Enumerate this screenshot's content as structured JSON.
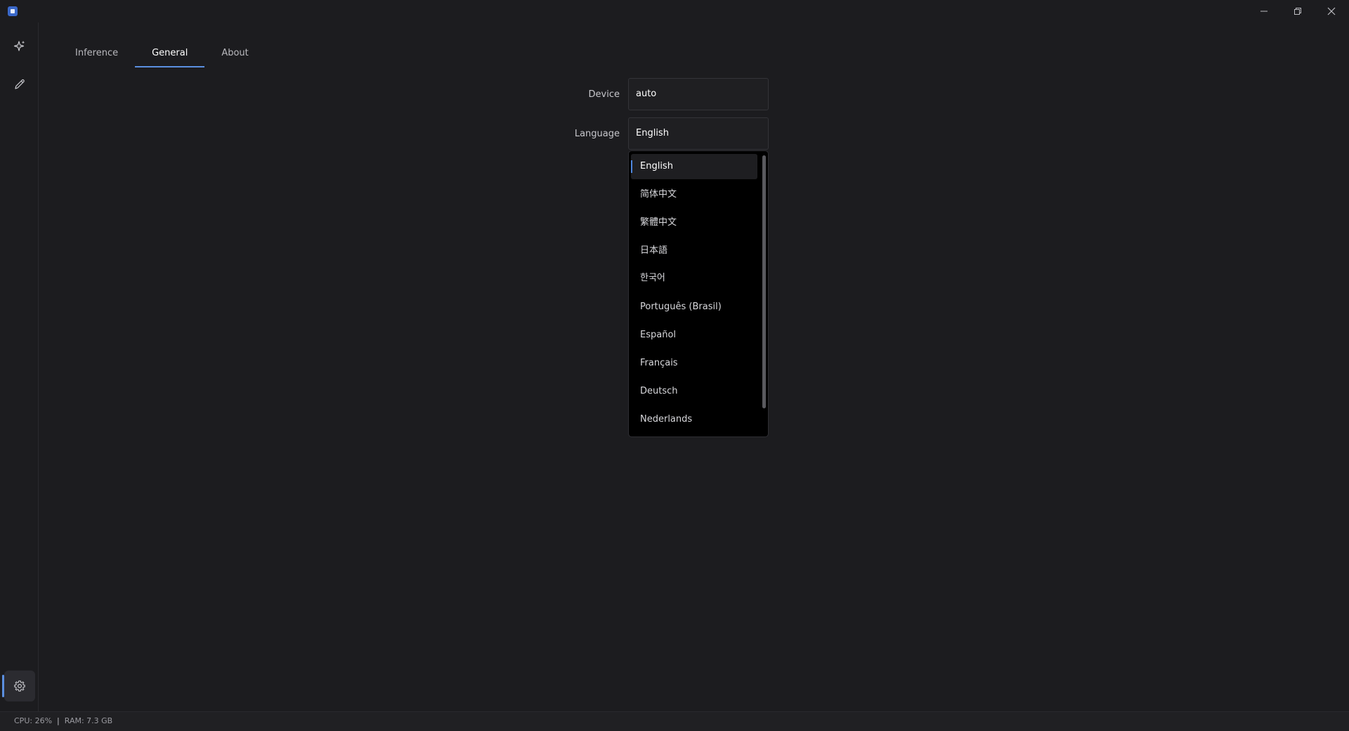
{
  "window": {
    "icon": "app-icon"
  },
  "tabs": [
    {
      "label": "Inference"
    },
    {
      "label": "General"
    },
    {
      "label": "About"
    }
  ],
  "settings": {
    "device_label": "Device",
    "device_value": "auto",
    "language_label": "Language",
    "language_value": "English"
  },
  "language_options": [
    "English",
    "简体中文",
    "繁體中文",
    "日本語",
    "한국어",
    "Português (Brasil)",
    "Español",
    "Français",
    "Deutsch",
    "Nederlands"
  ],
  "status": {
    "cpu": "CPU: 26%",
    "separator": "|",
    "ram": "RAM: 7.3 GB"
  },
  "colors": {
    "accent": "#5b8fe0",
    "background": "#1c1c1f",
    "dropdown_bg": "#000000"
  }
}
